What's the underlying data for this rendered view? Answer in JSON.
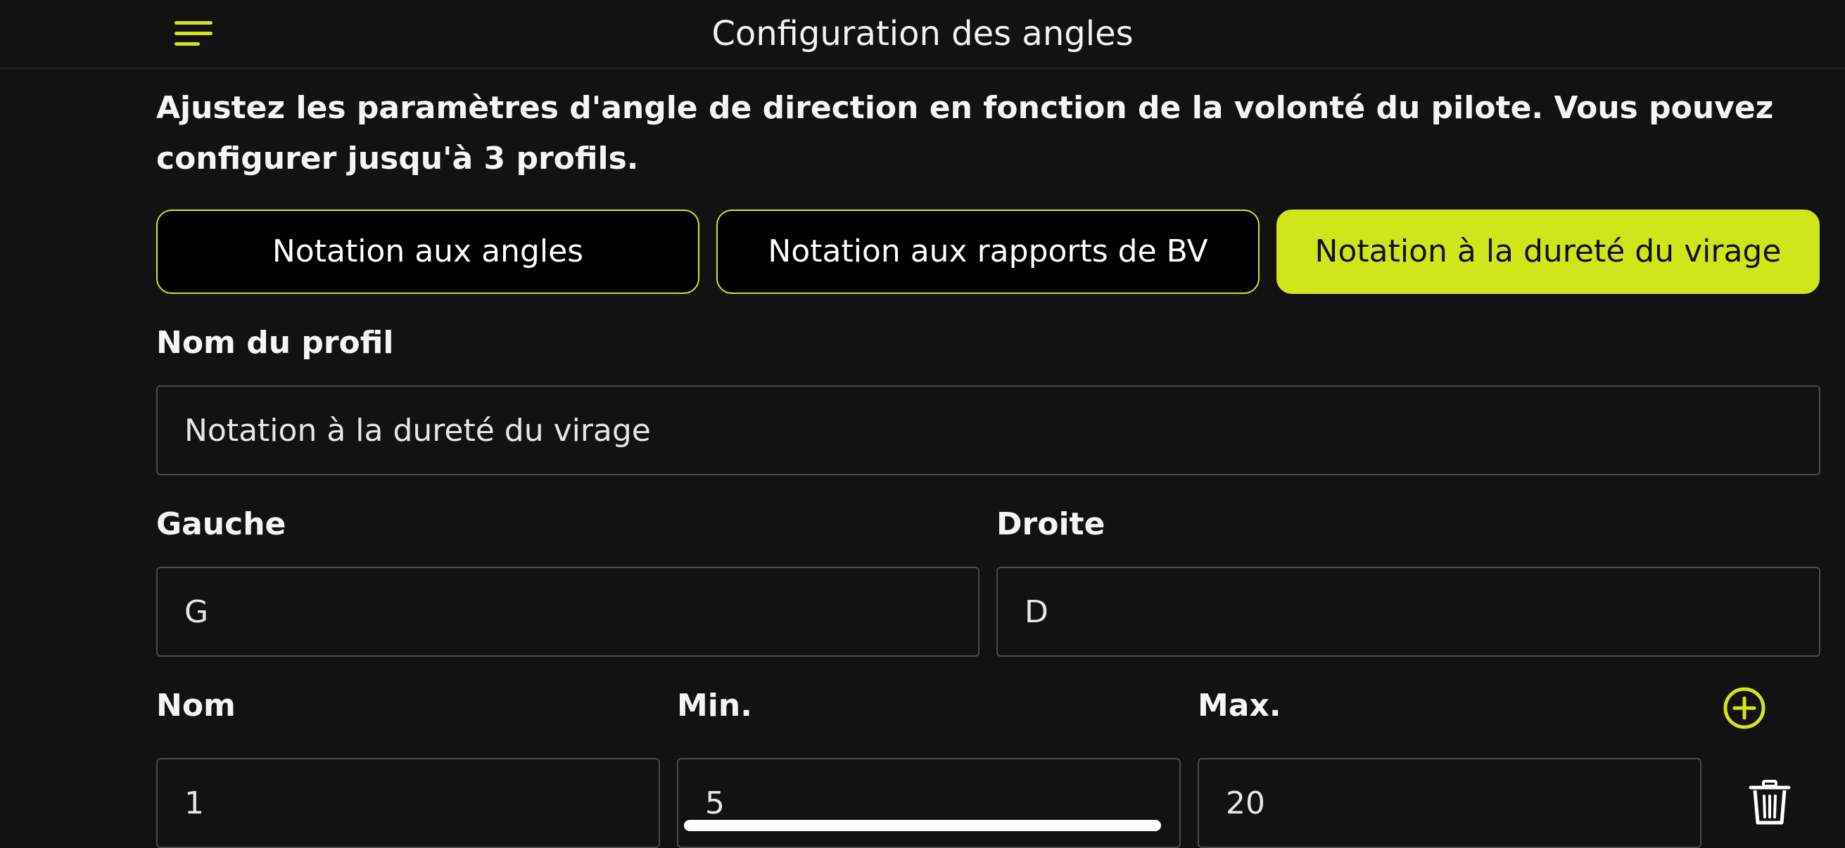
{
  "header": {
    "title": "Configuration des angles",
    "menu_icon": "hamburger-menu-icon"
  },
  "description": "Ajustez les paramètres d'angle de direction en fonction de la volonté du pilote. Vous pouvez configurer jusqu'à 3 profils.",
  "tabs": [
    {
      "label": "Notation aux angles",
      "active": false
    },
    {
      "label": "Notation aux rapports de BV",
      "active": false
    },
    {
      "label": "Notation à la dureté du virage",
      "active": true
    }
  ],
  "profile": {
    "name_label": "Nom du profil",
    "name_value": "Notation à la dureté du virage"
  },
  "directions": {
    "left_label": "Gauche",
    "left_value": "G",
    "right_label": "Droite",
    "right_value": "D"
  },
  "table": {
    "columns": [
      "Nom",
      "Min.",
      "Max."
    ],
    "rows": [
      {
        "name": "1",
        "min": "5",
        "max": "20"
      }
    ],
    "add_icon": "plus-circle-icon",
    "delete_icon": "trash-icon"
  },
  "colors": {
    "accent": "#cfe61a",
    "background": "#121212",
    "text": "#ffffff",
    "field_border": "#4a4a4a"
  }
}
